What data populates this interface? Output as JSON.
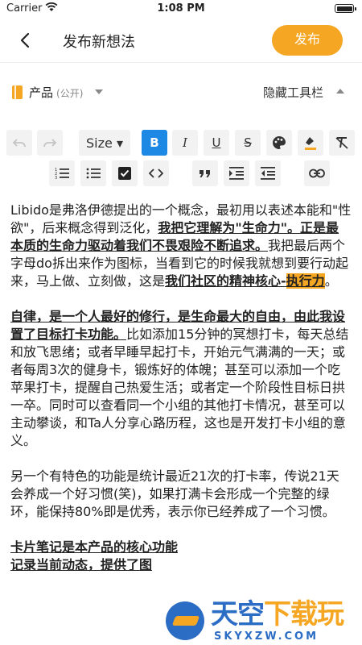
{
  "status_bar": {
    "carrier": "Carrier",
    "time": "1:08 PM"
  },
  "nav": {
    "title": "发布新想法",
    "publish_label": "发布"
  },
  "category": {
    "name": "产品",
    "visibility": "(公开)",
    "hide_toolbar_label": "隐藏工具栏"
  },
  "toolbar": {
    "size_label": "Size ▾",
    "bold": "B",
    "italic": "I",
    "underline": "U",
    "strike": "S"
  },
  "content": {
    "p1": {
      "t1": "Libido是弗洛伊德提出的一个概念，最初用以表述本能和\"性欲\"，后来概念得到泛化，",
      "b1": "我把它理解为\"生命力\"。正是最本质的生命力驱动着我们不畏艰险不断追求。",
      "t2": "我把最后两个字母do拆出来作为图标，当看到它的时候我就想到要行动起来，马上做、立刻做，这是",
      "b2": "我们社区的精神核心-",
      "hl": "执行力",
      "t3": "。"
    },
    "p2": {
      "b1": "自律，是一个人最好的修行，是生命最大的自由，由此我设置了目标打卡功能。",
      "t1": "比如添加15分钟的冥想打卡，每天总结和放飞思绪；或者早睡早起打卡，开始元气满满的一天；或者每周3次的健身卡，锻炼好的体魄；甚至可以添加一个吃苹果打卡，提醒自己热爱生活；或者定一个阶段性目标日拱一卒。同时可以查看同一个小组的其他打卡情况，甚至可以主动攀谈，和Ta人分享心路历程，这也是开发打卡小组的意义。"
    },
    "p3": {
      "t1": "另一个有特色的功能是统计最近21次的打卡率，传说21天会养成一个好习惯(笑)，如果打满卡会形成一个完整的绿环，能保持80%即是优秀，表示你已经养成了一个习惯。"
    },
    "p4": {
      "b1": "卡片笔记是本产品的核心功能",
      "b2": "记录当前动态，提供了图"
    }
  },
  "watermark": {
    "brand_blue": "天空",
    "brand_orange": "下载玩",
    "domain": "SKYXZW.COM"
  },
  "colors": {
    "accent": "#f5a623",
    "active_blue": "#1e88e5"
  }
}
